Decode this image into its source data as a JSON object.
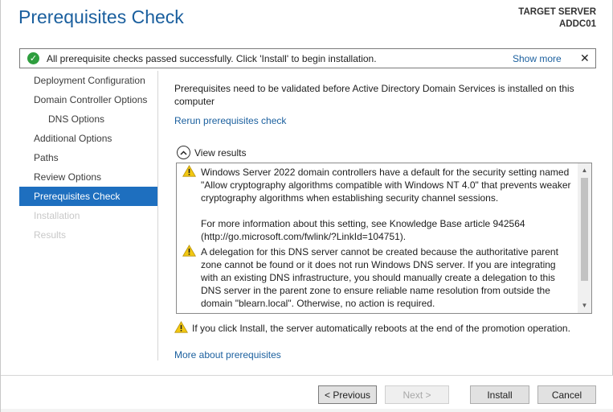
{
  "header": {
    "title": "Prerequisites Check",
    "target_label": "TARGET SERVER",
    "target_name": "ADDC01"
  },
  "notice": {
    "text": "All prerequisite checks passed successfully.  Click 'Install' to begin installation.",
    "show_more": "Show more",
    "close": "✕",
    "icon": "success-check-icon"
  },
  "sidebar": {
    "items": [
      {
        "label": "Deployment Configuration",
        "state": "normal"
      },
      {
        "label": "Domain Controller Options",
        "state": "normal"
      },
      {
        "label": "DNS Options",
        "state": "sub"
      },
      {
        "label": "Additional Options",
        "state": "normal"
      },
      {
        "label": "Paths",
        "state": "normal"
      },
      {
        "label": "Review Options",
        "state": "normal"
      },
      {
        "label": "Prerequisites Check",
        "state": "active"
      },
      {
        "label": "Installation",
        "state": "disabled"
      },
      {
        "label": "Results",
        "state": "disabled"
      }
    ]
  },
  "main": {
    "description": "Prerequisites need to be validated before Active Directory Domain Services is installed on this computer",
    "rerun_link": "Rerun prerequisites check",
    "view_results": "View results",
    "results": [
      {
        "icon": "warning-icon",
        "paragraphs": [
          "Windows Server 2022 domain controllers have a default for the security setting named \"Allow cryptography algorithms compatible with Windows NT 4.0\" that prevents weaker cryptography algorithms when establishing security channel sessions.",
          "For more information about this setting, see Knowledge Base article 942564 (http://go.microsoft.com/fwlink/?LinkId=104751)."
        ]
      },
      {
        "icon": "warning-icon",
        "paragraphs": [
          "A delegation for this DNS server cannot be created because the authoritative parent zone cannot be found or it does not run Windows DNS server. If you are integrating with an existing DNS infrastructure, you should manually create a delegation to this DNS server in the parent zone to ensure reliable name resolution from outside the domain \"blearn.local\". Otherwise, no action is required."
        ]
      }
    ],
    "reboot_warning": "If you click Install, the server automatically reboots at the end of the promotion operation.",
    "more_about_link": "More about prerequisites"
  },
  "footer": {
    "previous": "< Previous",
    "next": "Next >",
    "install": "Install",
    "cancel": "Cancel"
  },
  "colors": {
    "title_blue": "#1a5f9e",
    "active_blue": "#1e6fbf",
    "success_green": "#2e9e3e",
    "warning_yellow": "#f2c811"
  }
}
